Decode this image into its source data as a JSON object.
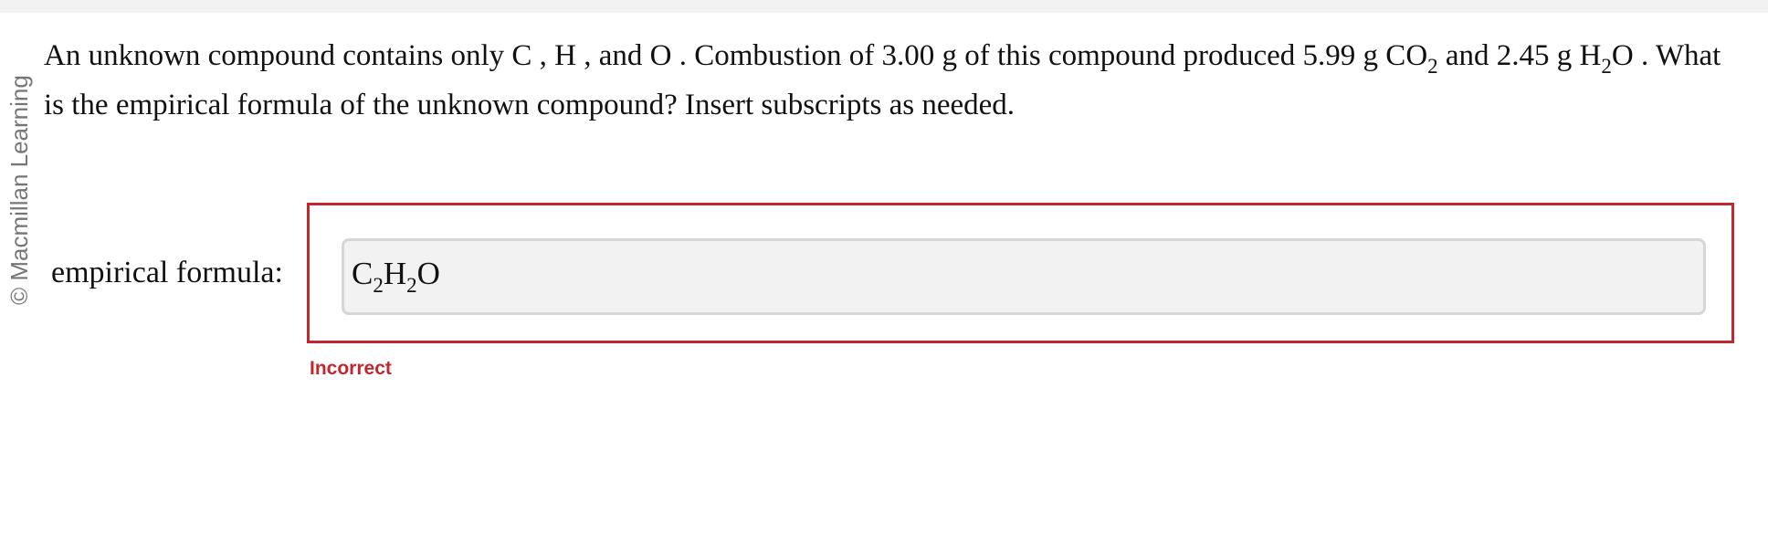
{
  "credit": "© Macmillan Learning",
  "question": {
    "part1": "An unknown compound contains only C , H , and O . Combustion of 3.00 g of this compound produced 5.99 g CO",
    "sub1": "2",
    "part2": " and 2.45 g H",
    "sub2": "2",
    "part3": "O . What is the empirical formula of the unknown compound? Insert subscripts as needed."
  },
  "answer": {
    "label": "empirical formula:",
    "value": {
      "c": "C",
      "c_sub": "2",
      "h": "H",
      "h_sub": "2",
      "o": "O"
    }
  },
  "status": {
    "text": "Incorrect",
    "color": "#c0282d"
  }
}
